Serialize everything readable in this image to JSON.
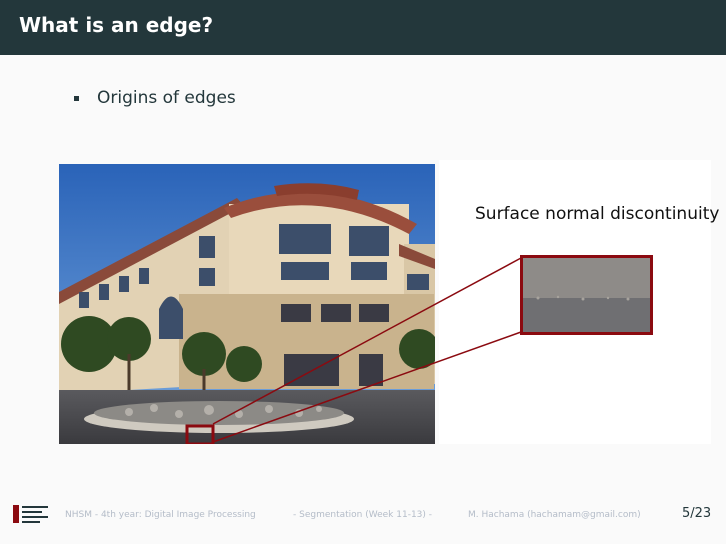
{
  "slide": {
    "title": "What is an edge?",
    "bullets": [
      "Origins of edges"
    ]
  },
  "figure": {
    "label": "Surface normal discontinuity",
    "highlight_color": "#8b0a10"
  },
  "footer": {
    "course": "NHSM - 4th year: Digital Image Processing",
    "section": "- Segmentation (Week 11-13) -",
    "author": "M. Hachama (hachamam@gmail.com)",
    "page": "5/23"
  },
  "colors": {
    "title_bar": "#23373b",
    "background": "#fafafa"
  }
}
